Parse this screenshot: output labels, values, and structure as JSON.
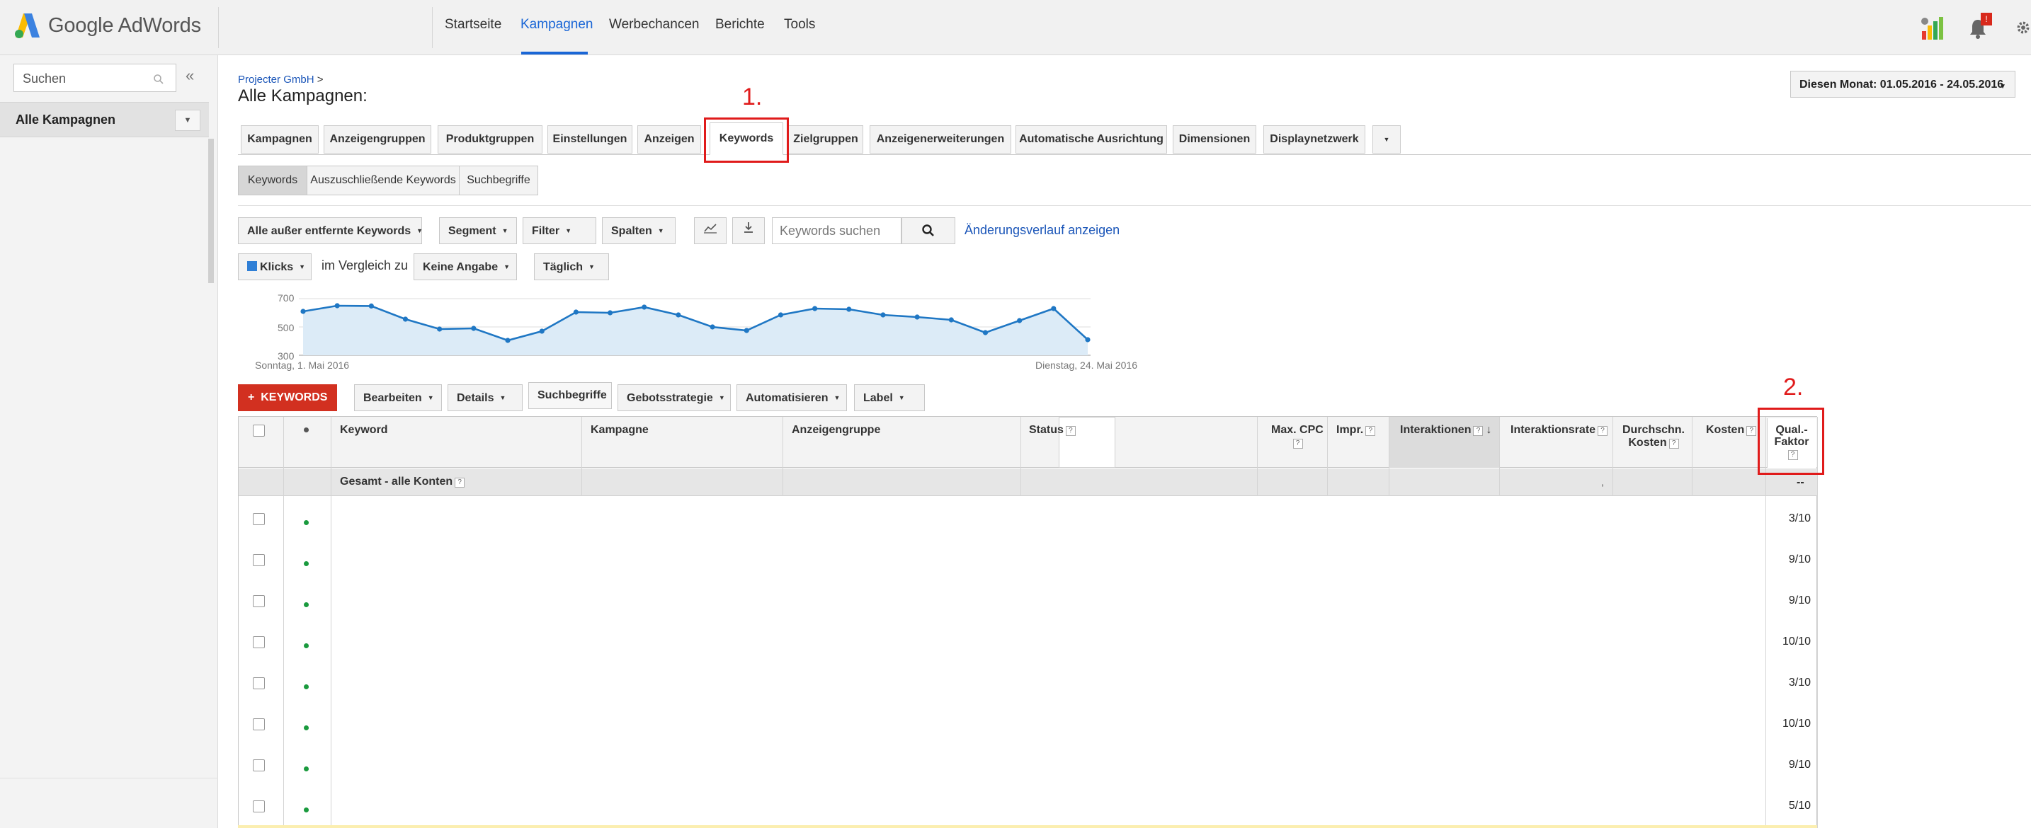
{
  "app": {
    "logo_text": "Google AdWords"
  },
  "topnav": {
    "items": [
      "Startseite",
      "Kampagnen",
      "Werbechancen",
      "Berichte",
      "Tools"
    ],
    "active": "Kampagnen",
    "notification_count": "!"
  },
  "sidebar": {
    "search_placeholder": "Suchen",
    "collapse": "«",
    "all_campaigns": "Alle Kampagnen"
  },
  "header": {
    "breadcrumb": "Projecter GmbH",
    "breadcrumb_sep": ">",
    "title": "Alle Kampagnen:",
    "date_range": "Diesen Monat: 01.05.2016 - 24.05.2016"
  },
  "tabs": {
    "items": [
      "Kampagnen",
      "Anzeigengruppen",
      "Produktgruppen",
      "Einstellungen",
      "Anzeigen",
      "Keywords",
      "Zielgruppen",
      "Anzeigenerweiterungen",
      "Automatische Ausrichtung",
      "Dimensionen",
      "Displaynetzwerk"
    ],
    "active": "Keywords"
  },
  "subtabs": {
    "items": [
      "Keywords",
      "Auszuschließende Keywords",
      "Suchbegriffe"
    ],
    "active": "Keywords"
  },
  "toolbar": {
    "filter_select": "Alle außer entfernte Keywords",
    "segment": "Segment",
    "filter": "Filter",
    "columns": "Spalten",
    "search_placeholder": "Keywords suchen",
    "change_history": "Änderungsverlauf anzeigen"
  },
  "chart_controls": {
    "metric": "Klicks",
    "compare_text": "im Vergleich zu",
    "compare_value": "Keine Angabe",
    "granularity": "Täglich"
  },
  "chart_data": {
    "type": "area",
    "yticks": [
      "700",
      "500",
      "300"
    ],
    "ylim": [
      300,
      700
    ],
    "x_start_label": "Sonntag, 1. Mai 2016",
    "x_end_label": "Dienstag, 24. Mai 2016",
    "values": [
      610,
      650,
      648,
      555,
      485,
      490,
      405,
      470,
      605,
      600,
      640,
      585,
      500,
      475,
      585,
      630,
      625,
      585,
      570,
      550,
      460,
      545,
      630,
      410
    ],
    "color": "#1f77c4"
  },
  "actions": {
    "add_keywords": "KEYWORDS",
    "add_plus": "+",
    "edit": "Bearbeiten",
    "details": "Details",
    "search_terms": "Suchbegriffe",
    "bid_strategy": "Gebotsstrategie",
    "automate": "Automatisieren",
    "label": "Label"
  },
  "table": {
    "columns": {
      "keyword": "Keyword",
      "campaign": "Kampagne",
      "adgroup": "Anzeigengruppe",
      "status": "Status",
      "max_cpc_1": "Max. CPC",
      "impr": "Impr.",
      "interactions": "Interaktionen",
      "interaction_rate": "Interaktionsrate",
      "avg_cost_1": "Durchschn.",
      "avg_cost_2": "Kosten",
      "cost": "Kosten",
      "qual_1": "Qual.-",
      "qual_2": "Faktor",
      "help": "?"
    },
    "total_label": "Gesamt - alle Konten",
    "total_quality": "--",
    "total_rate": ",",
    "rows": [
      {
        "quality": "3/10"
      },
      {
        "quality": "9/10"
      },
      {
        "quality": "9/10"
      },
      {
        "quality": "10/10"
      },
      {
        "quality": "3/10"
      },
      {
        "quality": "10/10"
      },
      {
        "quality": "9/10"
      },
      {
        "quality": "5/10"
      }
    ]
  },
  "annotations": {
    "one": "1.",
    "two": "2."
  }
}
